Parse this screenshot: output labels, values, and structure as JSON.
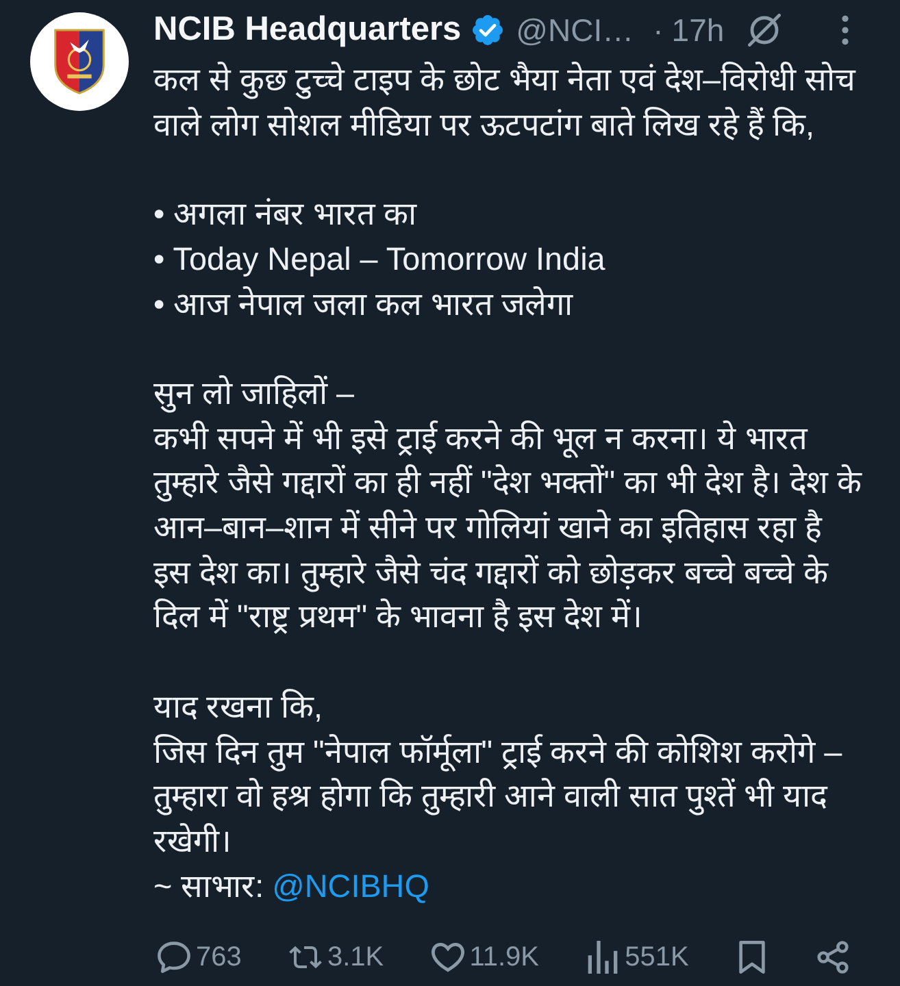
{
  "tweet": {
    "author": {
      "name": "NCIB Headquarters",
      "verified": true,
      "handle": "@NCI…",
      "separator": "·",
      "time": "17h"
    },
    "body": [
      {
        "kind": "paragraph",
        "lines": [
          "कल से कुछ टुच्चे टाइप के छोट भैया नेता एवं देश–विरोधी सोच वाले लोग सोशल मीडिया पर ऊटपटांग बाते लिख रहे हैं कि,"
        ]
      },
      {
        "kind": "bullets",
        "items": [
          "• अगला नंबर भारत का",
          "• Today Nepal – Tomorrow India",
          "• आज नेपाल जला कल भारत जलेगा"
        ]
      },
      {
        "kind": "paragraph",
        "lines": [
          "सुन लो जाहिलों –",
          "कभी सपने में भी इसे ट्राई करने की भूल न करना। ये भारत तुम्हारे जैसे गद्दारों का ही नहीं \"देश भक्तों\" का भी देश है। देश के आन–बान–शान में सीने पर गोलियां खाने का इतिहास रहा है इस देश का। तुम्हारे जैसे चंद गद्दारों को छोड़कर बच्चे बच्चे के दिल में \"राष्ट्र प्रथम\" के भावना है इस देश में।"
        ]
      },
      {
        "kind": "paragraph",
        "lines": [
          "याद रखना कि,",
          "जिस दिन तुम \"नेपाल फॉर्मूला\" ट्राई करने की कोशिश करोगे – तुम्हारा वो हश्र होगा कि तुम्हारी आने वाली सात पुश्तें भी याद रखेगी।"
        ]
      },
      {
        "kind": "credit",
        "label": "~ साभार:",
        "link": "@NCIBHQ"
      }
    ],
    "actions": [
      {
        "kind": "reply",
        "count": "763"
      },
      {
        "kind": "repost",
        "count": "3.1K"
      },
      {
        "kind": "like",
        "count": "11.9K"
      },
      {
        "kind": "views",
        "count": "551K"
      },
      {
        "kind": "bookmark"
      },
      {
        "kind": "share"
      }
    ]
  }
}
